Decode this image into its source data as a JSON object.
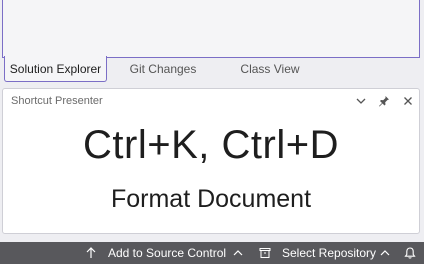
{
  "tabs": [
    {
      "label": "Solution Explorer",
      "active": true
    },
    {
      "label": "Git Changes",
      "active": false
    },
    {
      "label": "Class View",
      "active": false
    }
  ],
  "presenter": {
    "title": "Shortcut Presenter",
    "shortcut": "Ctrl+K, Ctrl+D",
    "command": "Format Document",
    "icons": [
      "chevron-down-icon",
      "pin-icon",
      "close-icon"
    ]
  },
  "statusbar": {
    "source_control": "Add to Source Control",
    "repository": "Select Repository",
    "icons": [
      "arrow-up-icon",
      "chevron-up-icon",
      "repository-icon",
      "chevron-up-icon",
      "bell-icon"
    ]
  },
  "colors": {
    "accent": "#7b6ec6",
    "statusbar": "#58585c"
  }
}
